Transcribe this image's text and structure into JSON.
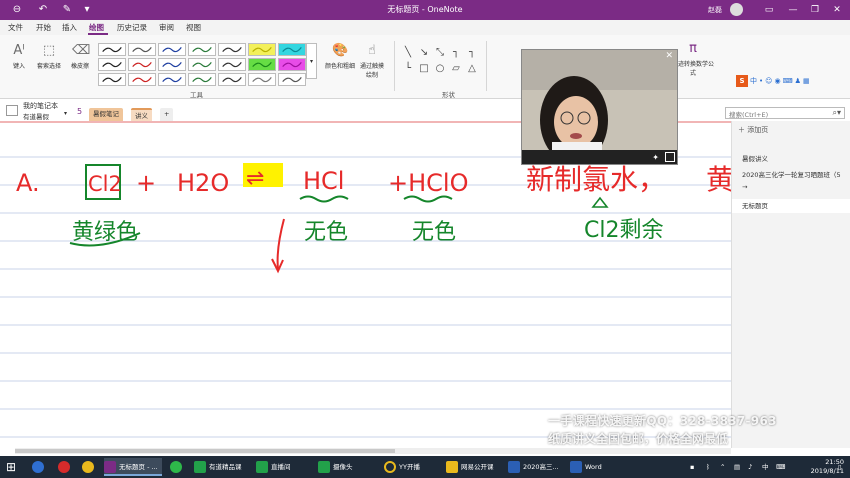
{
  "window": {
    "title": "无标题页 - OneNote",
    "user": "赵磊",
    "quick_access": [
      "back-icon",
      "undo-icon",
      "pen-mode-icon",
      "dropdown-icon"
    ]
  },
  "ribbon_tabs": [
    "文件",
    "开始",
    "插入",
    "绘图",
    "历史记录",
    "审阅",
    "视图"
  ],
  "active_tab": "绘图",
  "ribbon": {
    "type_label": "键入",
    "lasso_label": "套索选择",
    "eraser_label": "橡皮擦",
    "color_label": "颜色和粗细",
    "touch_label": "通过触摸绘制",
    "tools_group": "工具",
    "shapes_group": "形状",
    "convert_label": "墨迹转换数学公式"
  },
  "notebook": {
    "name": "我的笔记本",
    "sub": "有道暑假",
    "badge": "5",
    "sections": [
      "暑假笔记",
      "讲义"
    ]
  },
  "search": {
    "placeholder": "搜索(Ctrl+E)"
  },
  "pages_panel": {
    "add_page": "添加页",
    "pages": [
      "暑假讲义",
      "2020高三化学一轮复习晒题班（5",
      "→",
      "无标题页"
    ]
  },
  "ink": {
    "line1": [
      "A.",
      "Cl2",
      "+",
      "H2O",
      "⇌",
      "HCl",
      "+HClO",
      "新制氯水，",
      "黄"
    ],
    "line2": [
      "黄绿色",
      "无色",
      "无色",
      "Cl2剩余"
    ]
  },
  "watermark": {
    "line1": "一手课程快速更新QQ：328-3837-963",
    "line2": "纸质讲义全国包邮，价格全网最低"
  },
  "taskbar": {
    "items": [
      "无标题页 - ...",
      "有道精品课",
      "直播间",
      "摄像头",
      "YY开播",
      "网易公开课",
      "2020高三...",
      "Word"
    ],
    "time": "21:50",
    "date": "2019/8/11",
    "ime": "中"
  }
}
